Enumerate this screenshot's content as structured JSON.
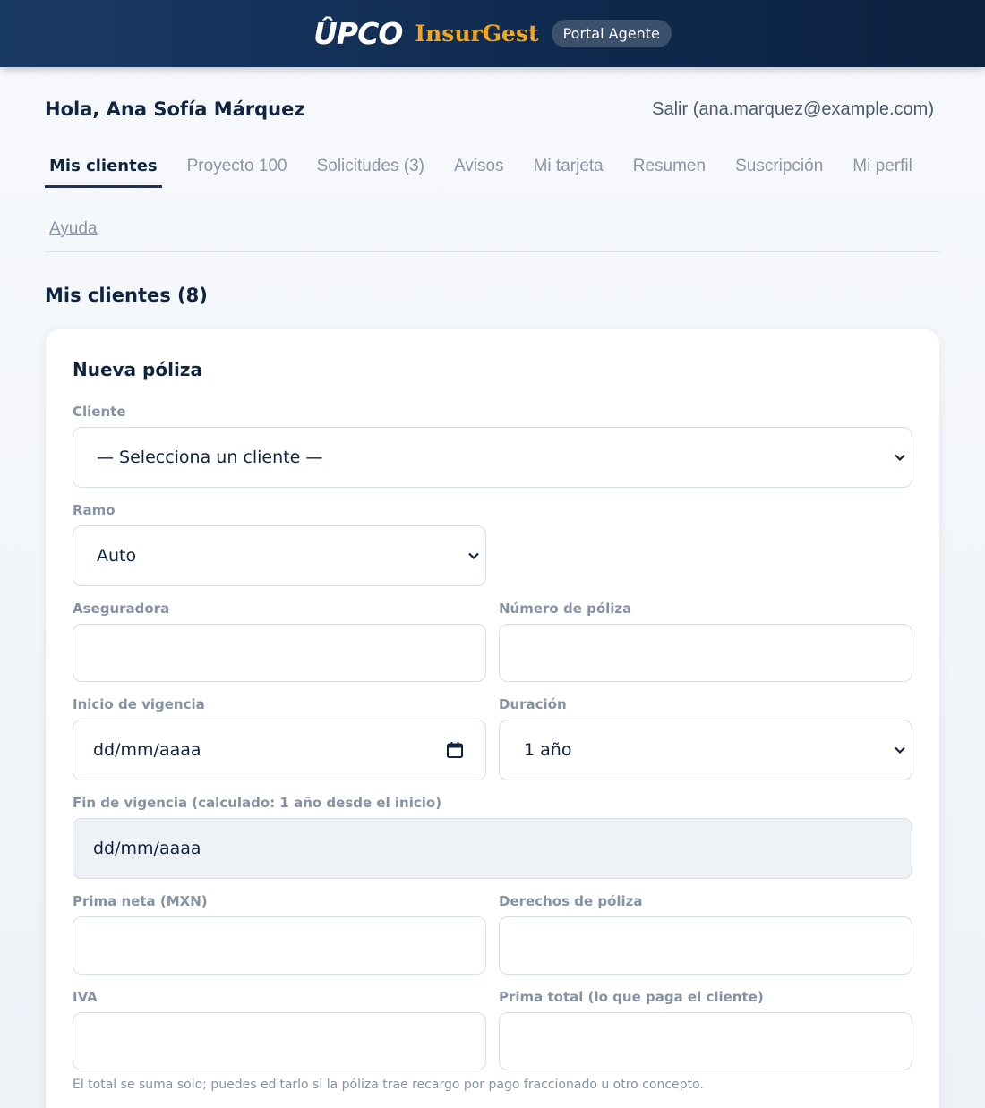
{
  "header": {
    "logo_upco": "ÛPCO",
    "logo_insurgest": "InsurGest",
    "badge": "Portal Agente"
  },
  "user": {
    "greeting": "Hola, Ana Sofía Márquez",
    "logout": "Salir (ana.marquez@example.com)"
  },
  "tabs": [
    {
      "label": "Mis clientes",
      "active": true
    },
    {
      "label": "Proyecto 100",
      "active": false
    },
    {
      "label": "Solicitudes (3)",
      "active": false
    },
    {
      "label": "Avisos",
      "active": false
    },
    {
      "label": "Mi tarjeta",
      "active": false
    },
    {
      "label": "Resumen",
      "active": false
    },
    {
      "label": "Suscripción",
      "active": false
    },
    {
      "label": "Mi perfil",
      "active": false
    }
  ],
  "help_link": "Ayuda",
  "section_title": "Mis clientes (8)",
  "form": {
    "title": "Nueva póliza",
    "cliente": {
      "label": "Cliente",
      "value": "— Selecciona un cliente —"
    },
    "ramo": {
      "label": "Ramo",
      "value": "Auto"
    },
    "aseguradora": {
      "label": "Aseguradora",
      "value": ""
    },
    "numero_poliza": {
      "label": "Número de póliza",
      "value": ""
    },
    "inicio_vigencia": {
      "label": "Inicio de vigencia",
      "value": "dd/mm/aaaa"
    },
    "duracion": {
      "label": "Duración",
      "value": "1 año"
    },
    "fin_vigencia": {
      "label": "Fin de vigencia (calculado: 1 año desde el inicio)",
      "value": "dd/mm/aaaa"
    },
    "prima_neta": {
      "label": "Prima neta (MXN)",
      "value": ""
    },
    "derechos_poliza": {
      "label": "Derechos de póliza",
      "value": ""
    },
    "iva": {
      "label": "IVA",
      "value": ""
    },
    "prima_total": {
      "label": "Prima total (lo que paga el cliente)",
      "value": ""
    },
    "hint": "El total se suma solo; puedes editarlo si la póliza trae recargo por pago fraccionado u otro concepto."
  },
  "icons": {
    "select_chevron": "chevron-down-icon",
    "date_picker": "calendar-icon"
  },
  "colors": {
    "header_bg": "#0f2a4f",
    "brand_accent": "#f3a51c",
    "text_primary": "#0f2440",
    "text_muted": "#8b96a5"
  }
}
